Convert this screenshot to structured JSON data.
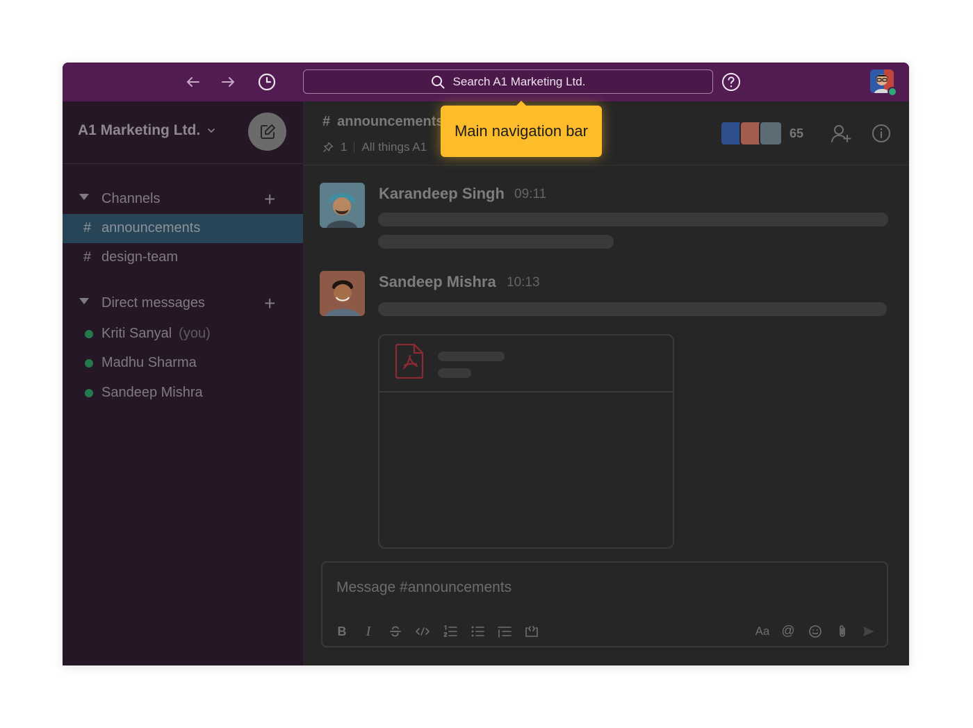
{
  "topbar": {
    "search_placeholder": "Search A1 Marketing Ltd.",
    "icons": [
      "back-arrow-icon",
      "forward-arrow-icon",
      "history-icon",
      "search-icon",
      "help-icon"
    ]
  },
  "sidebar": {
    "workspace_name": "A1 Marketing Ltd.",
    "channels_heading": "Channels",
    "channels": [
      {
        "hash": "#",
        "name": "announcements",
        "active": true
      },
      {
        "hash": "#",
        "name": "design-team",
        "active": false
      }
    ],
    "dm_heading": "Direct messages",
    "dms": [
      {
        "name": "Kriti Sanyal",
        "suffix": "(you)"
      },
      {
        "name": "Madhu Sharma",
        "suffix": ""
      },
      {
        "name": "Sandeep Mishra",
        "suffix": ""
      }
    ],
    "plus": "+"
  },
  "channel": {
    "hash": "#",
    "title": "announcements",
    "pins": "1",
    "topic": "All things A1",
    "member_count": "65"
  },
  "messages": [
    {
      "author": "Karandeep Singh",
      "time": "09:11"
    },
    {
      "author": "Sandeep Mishra",
      "time": "10:13"
    }
  ],
  "composer": {
    "placeholder": "Message #announcements",
    "tools": {
      "bold": "B",
      "italic": "I",
      "format": "Aa",
      "mention": "@"
    }
  },
  "tooltip": {
    "text": "Main navigation bar"
  },
  "colors": {
    "topbar": "#521b51",
    "sidebar": "#261727",
    "active_channel": "#274556",
    "tooltip": "#fdbd2a",
    "presence": "#2bac76"
  }
}
